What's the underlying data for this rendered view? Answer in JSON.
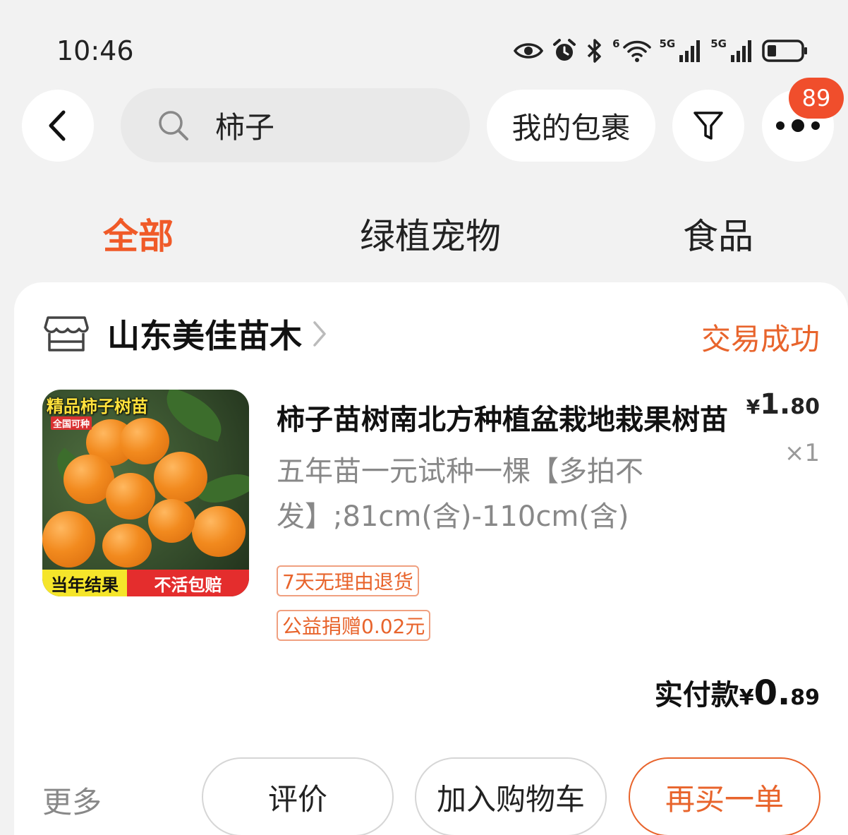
{
  "status_bar": {
    "time": "10:46",
    "icons": [
      "eye-icon",
      "alarm-icon",
      "bluetooth-icon",
      "wifi-icon",
      "signal-5g-icon",
      "signal-5g-icon",
      "battery-icon"
    ],
    "wifi_label": "6",
    "sim1_label": "5G",
    "sim2_label": "5G"
  },
  "top_bar": {
    "search_value": "柿子",
    "package_label": "我的包裹",
    "more_badge": "89"
  },
  "tabs": [
    {
      "label": "全部",
      "active": true
    },
    {
      "label": "绿植宠物",
      "active": false
    },
    {
      "label": "食品",
      "active": false
    }
  ],
  "order": {
    "store_name": "山东美佳苗木",
    "status": "交易成功",
    "image_text": {
      "title": "精品柿子树苗",
      "subtitle": "全国可种",
      "band_left": "当年结果",
      "band_right": "不活包赔"
    },
    "product_title": "柿子苗树南北方种植盆栽地栽果树苗",
    "product_spec": "五年苗一元试种一棵【多拍不发】;81cm(含)-110cm(含)",
    "price_symbol": "¥",
    "price_int": "1.",
    "price_dec": "80",
    "quantity": "×1",
    "tags": [
      "7天无理由退货",
      "公益捐赠0.02元"
    ],
    "paid_label": "实付款",
    "paid_symbol": "¥",
    "paid_int": "0.",
    "paid_dec": "89"
  },
  "actions": {
    "more": "更多",
    "review": "评价",
    "add_to_cart": "加入购物车",
    "rebuy": "再买一单"
  },
  "colors": {
    "accent": "#f05a28",
    "status": "#e8642c",
    "badge": "#f04e2c"
  }
}
